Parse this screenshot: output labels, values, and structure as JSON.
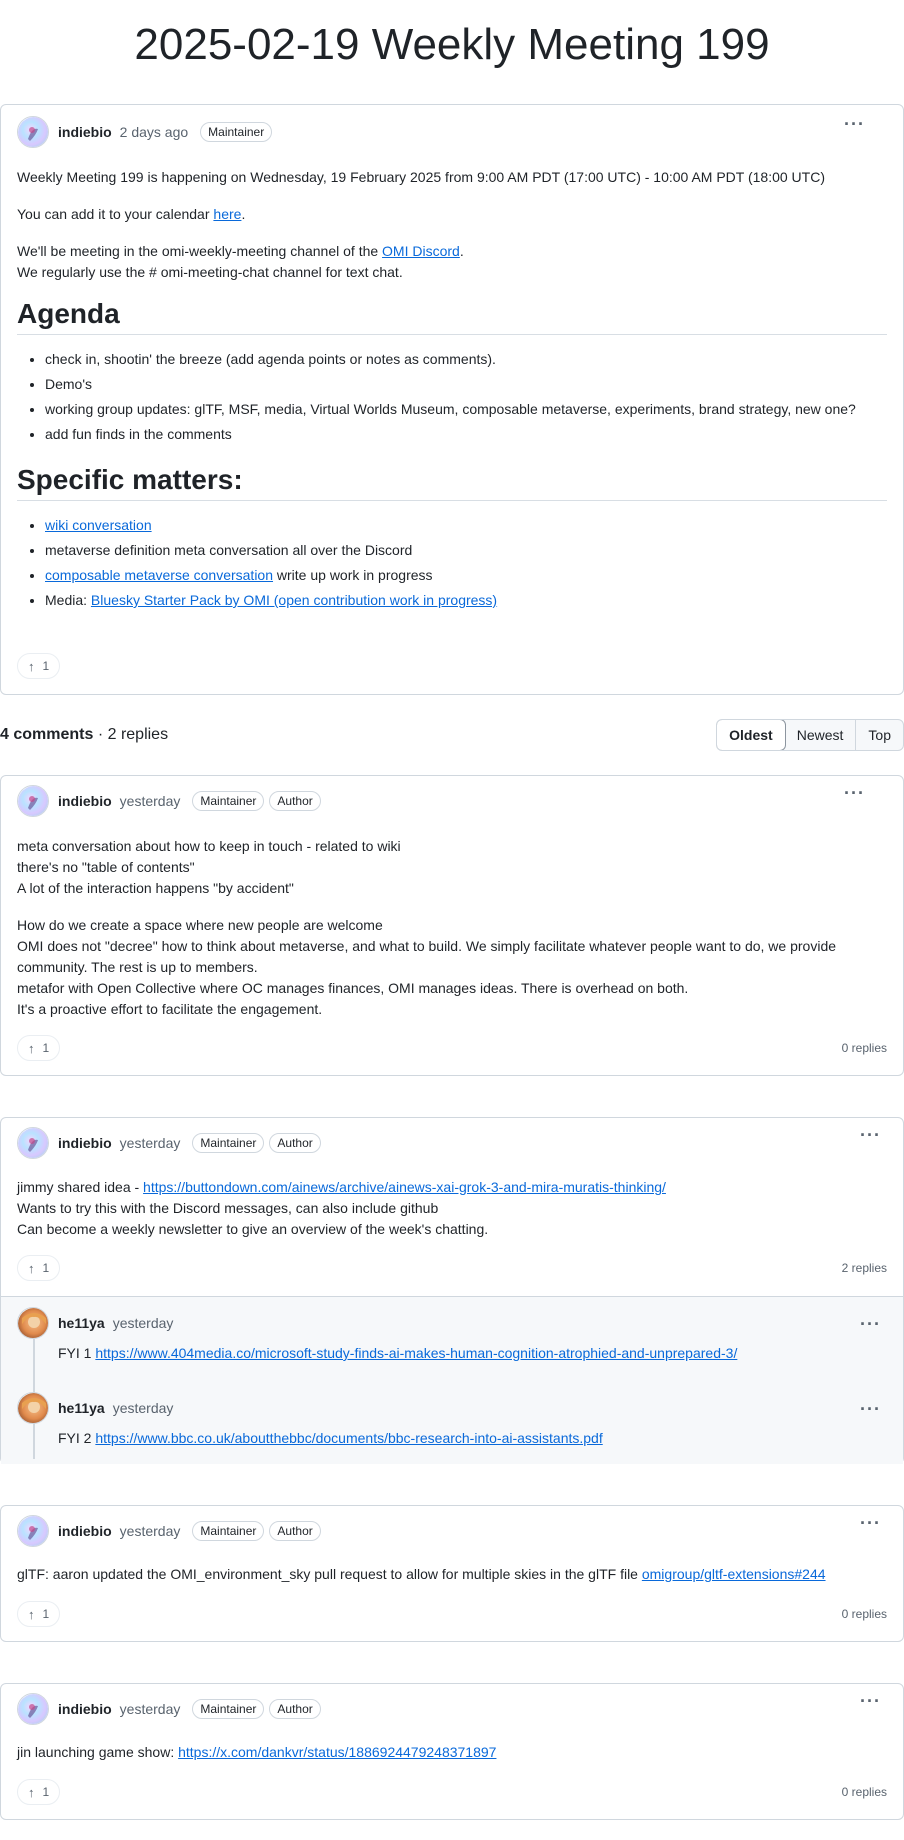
{
  "title": "2025-02-19 Weekly Meeting 199",
  "post": {
    "author": "indiebio",
    "time": "2 days ago",
    "badge": "Maintainer",
    "para1": "Weekly Meeting 199 is happening on Wednesday, 19 February 2025 from 9:00 AM PDT (17:00 UTC) - 10:00 AM PDT (18:00 UTC)",
    "para2_pre": "You can add it to your calendar ",
    "para2_link": "here",
    "para2_post": ".",
    "para3_pre": "We'll be meeting in the omi-weekly-meeting channel of the ",
    "para3_link": "OMI Discord",
    "para3_post": ".",
    "para3_line2": "We regularly use the # omi-meeting-chat channel for text chat.",
    "agenda_heading": "Agenda",
    "agenda": [
      "check in, shootin' the breeze (add agenda points or notes as comments).",
      "Demo's",
      "working group updates: glTF, MSF, media, Virtual Worlds Museum, composable metaverse, experiments, brand strategy, new one?",
      "add fun finds in the comments"
    ],
    "specific_heading": "Specific matters:",
    "specific": {
      "item1_link": "wiki conversation",
      "item2": "metaverse definition meta conversation all over the Discord",
      "item3_link": "composable metaverse conversation",
      "item3_post": " write up work in progress",
      "item4_pre": "Media: ",
      "item4_link": "Bluesky Starter Pack by OMI (open contribution work in progress)"
    },
    "upvotes": "1"
  },
  "summary": {
    "comments": "4 comments",
    "dot": " · ",
    "replies": "2 replies"
  },
  "sort": {
    "oldest": "Oldest",
    "newest": "Newest",
    "top": "Top"
  },
  "comments": [
    {
      "author": "indiebio",
      "time": "yesterday",
      "badge1": "Maintainer",
      "badge2": "Author",
      "lines_a": [
        "meta conversation about how to keep in touch - related to wiki",
        "there's no \"table of contents\"",
        "A lot of the interaction happens \"by accident\""
      ],
      "para_b": "How do we create a space where new people are welcome\nOMI does not \"decree\" how to think about metaverse, and what to build. We simply facilitate whatever people want to do, we provide community. The rest is up to members.\nmetafor with Open Collective where OC manages finances, OMI manages ideas. There is overhead on both.\nIt's a proactive effort to facilitate the engagement.",
      "upvotes": "1",
      "replies": "0 replies"
    },
    {
      "author": "indiebio",
      "time": "yesterday",
      "badge1": "Maintainer",
      "badge2": "Author",
      "line1_pre": "jimmy shared idea - ",
      "line1_link": "https://buttondown.com/ainews/archive/ainews-xai-grok-3-and-mira-muratis-thinking/",
      "line2": "Wants to try this with the Discord messages, can also include github",
      "line3": "Can become a weekly newsletter to give an overview of the week's chatting.",
      "upvotes": "1",
      "replies": "2 replies",
      "reply_items": [
        {
          "author": "he11ya",
          "time": "yesterday",
          "pre": "FYI 1 ",
          "link": "https://www.404media.co/microsoft-study-finds-ai-makes-human-cognition-atrophied-and-unprepared-3/"
        },
        {
          "author": "he11ya",
          "time": "yesterday",
          "pre": "FYI 2 ",
          "link": "https://www.bbc.co.uk/aboutthebbc/documents/bbc-research-into-ai-assistants.pdf"
        }
      ]
    },
    {
      "author": "indiebio",
      "time": "yesterday",
      "badge1": "Maintainer",
      "badge2": "Author",
      "pre": "glTF: aaron updated the OMI_environment_sky pull request to allow for multiple skies in the glTF file ",
      "link": "omigroup/gltf-extensions#244",
      "upvotes": "1",
      "replies": "0 replies"
    },
    {
      "author": "indiebio",
      "time": "yesterday",
      "badge1": "Maintainer",
      "badge2": "Author",
      "pre": "jin launching game show: ",
      "link": "https://x.com/dankvr/status/1886924479248371897",
      "upvotes": "1",
      "replies": "0 replies"
    }
  ]
}
